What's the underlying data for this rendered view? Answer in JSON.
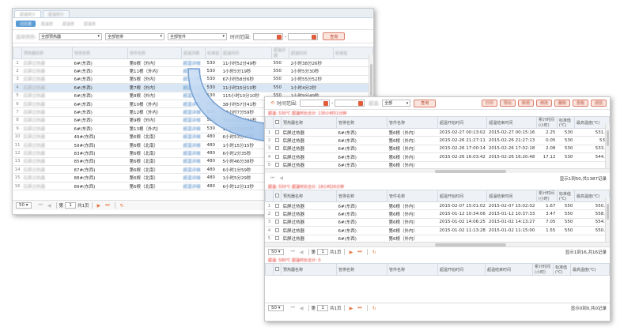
{
  "window1": {
    "filter": {
      "select1": "全部预热器",
      "select2": "全部管排",
      "select3": "全部管件",
      "time_label": "时间范围:",
      "range_sep": "-",
      "query_button": "查询"
    },
    "rows": [
      {
        "num": "1",
        "pipe": "6#(东西)",
        "part": "第6根（外内）",
        "v1": "530",
        "dur": "11小时52分49秒",
        "v2": "550",
        "time2": "2小时38分26秒"
      },
      {
        "num": "2",
        "pipe": "6#(东西)",
        "part": "第11根（外内）",
        "v1": "530",
        "dur": "1小时5分19秒",
        "v2": "550",
        "time2": "1小时5分30秒"
      },
      {
        "num": "3",
        "pipe": "6#(东西)",
        "part": "第5根（外内）",
        "v1": "530",
        "dur": "67小时58分6秒",
        "v2": "550",
        "time2": "1小时55分52秒"
      },
      {
        "num": "4",
        "pipe": "6#(东西)",
        "part": "第7根（外内）",
        "v1": "530",
        "dur": "11小时15分10秒",
        "v2": "550",
        "time2": "1小时4分2秒"
      },
      {
        "num": "5",
        "pipe": "6#(东西)",
        "part": "第8根（外内）",
        "v1": "530",
        "dur": "115小时10分10秒",
        "v2": "550",
        "time2": "1小时9分49秒"
      },
      {
        "num": "6",
        "pipe": "6#(东西)",
        "part": "第10根（外内）",
        "v1": "530",
        "dur": "38小时57分41秒",
        "v2": "550",
        "time2": "1小时45分22秒"
      },
      {
        "num": "7",
        "pipe": "6#(东西)",
        "part": "第12根（外内）",
        "v1": "530",
        "dur": "37小时7分59秒",
        "v2": "550",
        "time2": "1小时5分22秒"
      },
      {
        "num": "8",
        "pipe": "6#(东西)",
        "part": "第9根（外内）",
        "v1": "530",
        "dur": "35小时23分30秒",
        "v2": "550",
        "time2": "1小时2分19秒"
      },
      {
        "num": "9",
        "pipe": "6#(东西)",
        "part": "第13根（外内）",
        "v1": "530",
        "dur": "11小时6分35秒",
        "v2": "",
        "time2": ""
      },
      {
        "num": "10",
        "pipe": "49#(东西)",
        "part": "第6根（北南）",
        "v1": "480",
        "dur": "6小时53分45秒",
        "v2": "",
        "time2": ""
      },
      {
        "num": "11",
        "pipe": "59#(东西)",
        "part": "第6根（北南）",
        "v1": "480",
        "dur": "1小时15分15秒",
        "v2": "",
        "time2": ""
      },
      {
        "num": "12",
        "pipe": "83#(东西)",
        "part": "第6根（北南）",
        "v1": "480",
        "dur": "6小时2分35秒",
        "v2": "",
        "time2": ""
      },
      {
        "num": "13",
        "pipe": "85#(东西)",
        "part": "第6根（北南）",
        "v1": "480",
        "dur": "5小时46分38秒",
        "v2": "",
        "time2": ""
      },
      {
        "num": "14",
        "pipe": "87#(东西)",
        "part": "第6根（北南）",
        "v1": "480",
        "dur": "6小时1分59秒",
        "v2": "",
        "time2": ""
      },
      {
        "num": "15",
        "pipe": "88#(东西)",
        "part": "第6根（北南）",
        "v1": "480",
        "dur": "1小时5分29秒",
        "v2": "",
        "time2": ""
      },
      {
        "num": "16",
        "pipe": "89#(东西)",
        "part": "第6根（北南）",
        "v1": "480",
        "dur": "6小时12分13秒",
        "v2": "",
        "time2": ""
      }
    ],
    "pager": {
      "size": "50",
      "page_label": "第",
      "page": "1",
      "total": "共1页"
    }
  },
  "window2": {
    "filter": {
      "time_label": "时间范围:",
      "range_sep": "-",
      "select1": "全部",
      "query_button": "查询"
    },
    "header": {
      "c1": "预热器名称",
      "c2": "管排名称",
      "c3": "管件名称",
      "c4": "超温开始时间",
      "c5": "超温结束时间",
      "c6": "累计时间(小时)",
      "c7": "标准值(℃)",
      "c8": "最高温度(℃)"
    },
    "grid1": [
      {
        "num": "1",
        "name": "后屏过热器",
        "pipe": "6#(东西)",
        "part": "第6根（外内）",
        "start": "2015-02-27 00:13:02",
        "end": "2015-02-27 00:15:16",
        "hours": "2.25",
        "std": "530",
        "max": "531.8"
      },
      {
        "num": "2",
        "name": "后屏过热器",
        "pipe": "6#(东西)",
        "part": "第6根（外内）",
        "start": "2015-02-26 21:27:11",
        "end": "2015-02-26 21:27:13",
        "hours": "0.05",
        "std": "530",
        "max": "530"
      },
      {
        "num": "3",
        "name": "后屏过热器",
        "pipe": "6#(东西)",
        "part": "第6根（外内）",
        "start": "2015-02-26 17:00:14",
        "end": "2015-02-26 17:02:18",
        "hours": "2.08",
        "std": "530",
        "max": "533.2"
      },
      {
        "num": "4",
        "name": "后屏过热器",
        "pipe": "6#(东西)",
        "part": "第6根（外内）",
        "start": "2015-02-26 16:03:42",
        "end": "2015-02-26 16:20:48",
        "hours": "17.12",
        "std": "530",
        "max": "544.5"
      },
      {
        "num": "5",
        "name": "后屏过热器",
        "pipe": "6#(东西)",
        "part": "第6根（外内）",
        "start": "",
        "end": "",
        "hours": "",
        "std": "",
        "max": ""
      }
    ],
    "info1": "显示1到50,共1387记录",
    "grid2": [
      {
        "num": "1",
        "name": "后屏过热器",
        "pipe": "6#(东西)",
        "part": "第6根（外内）",
        "start": "2015-02-07 15:01:02",
        "end": "2015-02-07 15:02:02",
        "hours": "1.67",
        "std": "550",
        "max": "550.9"
      },
      {
        "num": "2",
        "name": "后屏过热器",
        "pipe": "6#(东西)",
        "part": "第6根（外内）",
        "start": "2015-01-12 10:34:06",
        "end": "2015-01-12 10:37:33",
        "hours": "3.47",
        "std": "550",
        "max": "558.5"
      },
      {
        "num": "3",
        "name": "后屏过热器",
        "pipe": "6#(东西)",
        "part": "第6根（外内）",
        "start": "2015-01-02 14:06:25",
        "end": "2015-01-02 14:13:27",
        "hours": "7.05",
        "std": "550",
        "max": "554.9"
      },
      {
        "num": "4",
        "name": "后屏过热器",
        "pipe": "6#(东西)",
        "part": "第6根（外内）",
        "start": "2015-01-02 11:13:28",
        "end": "2015-01-02 11:15:00",
        "hours": "1.55",
        "std": "550",
        "max": "550.7"
      },
      {
        "num": "5",
        "name": "后屏过热器",
        "pipe": "6#(东西)",
        "part": "第6根（外内）",
        "start": "",
        "end": "",
        "hours": "",
        "std": "",
        "max": ""
      }
    ],
    "pager2": {
      "size": "50",
      "page_label": "第",
      "page": "1",
      "total": "共1页",
      "info": "显示1到16,共16记录"
    },
    "pager3": {
      "size": "50",
      "page_label": "第",
      "page": "1",
      "total": "共1页",
      "info": "显示0到0,共0记录"
    }
  },
  "colors": {
    "accent": "#e2743f",
    "header_blue": "#5b9bd5",
    "selected_row": "#d9e7f5"
  }
}
